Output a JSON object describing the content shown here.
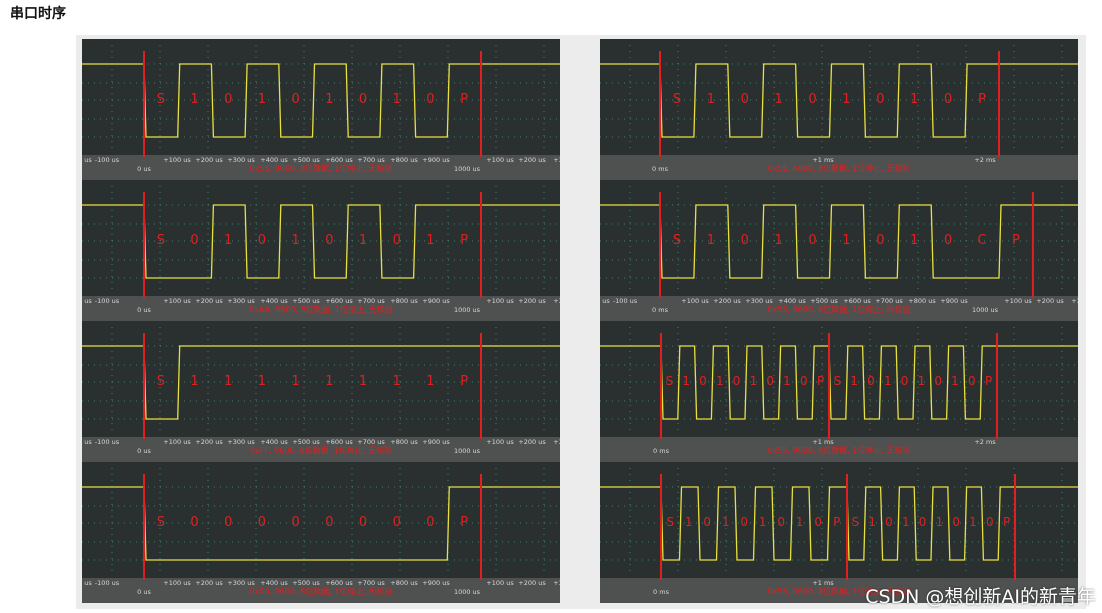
{
  "page": {
    "title": "串口时序",
    "watermark": "CSDN @想创新AI的新青年"
  },
  "colors": {
    "scope_bg": "#2a302f",
    "ruler_bg": "#4e5150",
    "trace": "#e8e040",
    "cursor": "#e02020",
    "label": "#e02020",
    "tick_text": "#d8d8d8",
    "grid": "#3f8a78"
  },
  "captures": [
    {
      "id": "c1",
      "caption": "0x55, 9600, 8位数据, 1位停止, 无校验",
      "frames": [
        {
          "bits": "0101010101",
          "labels": [
            "S",
            "1",
            "0",
            "1",
            "0",
            "1",
            "0",
            "1",
            "0",
            "P"
          ]
        }
      ],
      "origin_label": "0 us",
      "mid_label": "1000 us",
      "ticks": [
        "us",
        "-100 us",
        "+100 us",
        "+200 us",
        "+300 us",
        "+400 us",
        "+500 us",
        "+600 us",
        "+700 us",
        "+800 us",
        "+900 us",
        "+100 us",
        "+200 us",
        "+3"
      ]
    },
    {
      "id": "c2",
      "caption": "0x55, 4800, 8位数据, 1位停止, 无校验",
      "frames": [
        {
          "bits": "0101010101",
          "labels": [
            "S",
            "1",
            "0",
            "1",
            "0",
            "1",
            "0",
            "1",
            "0",
            "P"
          ]
        }
      ],
      "origin_label": "0 ms",
      "mid_label": "",
      "ticks": [
        "+1 ms",
        "+2 ms"
      ]
    },
    {
      "id": "c3",
      "caption": "0xAA, 9600, 8位数据, 1位停止, 无校验",
      "frames": [
        {
          "bits": "0010101011",
          "labels": [
            "S",
            "0",
            "1",
            "0",
            "1",
            "0",
            "1",
            "0",
            "1",
            "P"
          ]
        }
      ],
      "origin_label": "0 us",
      "mid_label": "1000 us",
      "ticks": [
        "us",
        "-100 us",
        "+100 us",
        "+200 us",
        "+300 us",
        "+400 us",
        "+500 us",
        "+600 us",
        "+700 us",
        "+800 us",
        "+900 us",
        "+100 us",
        "+200 us",
        "+3"
      ]
    },
    {
      "id": "c4",
      "caption": "0x55, 9600, 8位数据, 1位停止, 偶校验",
      "frames": [
        {
          "bits": "01010101001",
          "labels": [
            "S",
            "1",
            "0",
            "1",
            "0",
            "1",
            "0",
            "1",
            "0",
            "C",
            "P"
          ]
        }
      ],
      "origin_label": "0 ms",
      "mid_label": "1000 us",
      "ticks": [
        "us",
        "-100 us",
        "+100 us",
        "+200 us",
        "+300 us",
        "+400 us",
        "+500 us",
        "+600 us",
        "+700 us",
        "+800 us",
        "+900 us",
        "+100 us",
        "+200 us",
        "+3"
      ]
    },
    {
      "id": "c5",
      "caption": "0xFF, 9600, 8位数据, 1位停止, 无校验",
      "frames": [
        {
          "bits": "0111111111",
          "labels": [
            "S",
            "1",
            "1",
            "1",
            "1",
            "1",
            "1",
            "1",
            "1",
            "P"
          ]
        }
      ],
      "origin_label": "0 us",
      "mid_label": "1000 us",
      "ticks": [
        "us",
        "-100 us",
        "+100 us",
        "+200 us",
        "+300 us",
        "+400 us",
        "+500 us",
        "+600 us",
        "+700 us",
        "+800 us",
        "+900 us",
        "+100 us",
        "+200 us",
        "+3"
      ]
    },
    {
      "id": "c6",
      "caption": "0x55, 9600, 8位数据, 1位停止, 无校验",
      "frames": [
        {
          "bits": "0101010101",
          "labels": [
            "S",
            "1",
            "0",
            "1",
            "0",
            "1",
            "0",
            "1",
            "0",
            "P"
          ]
        },
        {
          "bits": "0101010101",
          "labels": [
            "S",
            "1",
            "0",
            "1",
            "0",
            "1",
            "0",
            "1",
            "0",
            "P"
          ]
        }
      ],
      "origin_label": "0 ms",
      "mid_label": "",
      "ticks": [
        "+1 ms",
        "+2 ms"
      ]
    },
    {
      "id": "c7",
      "caption": "0x00, 9600, 8位数据, 1位停止, 无校验",
      "frames": [
        {
          "bits": "0000000001",
          "labels": [
            "S",
            "0",
            "0",
            "0",
            "0",
            "0",
            "0",
            "0",
            "0",
            "P"
          ]
        }
      ],
      "origin_label": "0 us",
      "mid_label": "1000 us",
      "ticks": [
        "us",
        "-100 us",
        "+100 us",
        "+200 us",
        "+300 us",
        "+400 us",
        "+500 us",
        "+600 us",
        "+700 us",
        "+800 us",
        "+900 us",
        "+100 us",
        "+200 us",
        "+3"
      ]
    },
    {
      "id": "c8",
      "caption": "0x55, 9600, 8位数据, 1位停止, 无校验",
      "frames": [
        {
          "bits": "0101010101",
          "labels": [
            "S",
            "1",
            "0",
            "1",
            "0",
            "1",
            "0",
            "1",
            "0",
            "P"
          ]
        },
        {
          "bits": "0101010101",
          "labels": [
            "S",
            "1",
            "0",
            "1",
            "0",
            "1",
            "0",
            "1",
            "0",
            "P"
          ]
        }
      ],
      "origin_label": "0 ms",
      "mid_label": "",
      "ticks": [
        "+1 ms"
      ]
    }
  ]
}
